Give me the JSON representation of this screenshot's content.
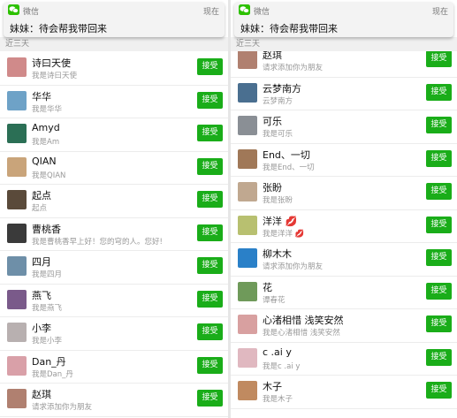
{
  "left": {
    "notification": {
      "app": "微信",
      "time": "现在",
      "message": "妹妹：待会帮我带回来"
    },
    "section_label": "近三天",
    "requests": [
      {
        "name": "诗曰天使",
        "sub": "我是诗曰天使",
        "avatar": "#d08a8a"
      },
      {
        "name": "华华",
        "sub": "我是华华",
        "avatar": "#6ea2c7"
      },
      {
        "name": "Amyd",
        "sub": "我是Am",
        "avatar": "#2b6f55"
      },
      {
        "name": "QIAN",
        "sub": "我是QIAN",
        "avatar": "#c9a47a"
      },
      {
        "name": "起点",
        "sub": "起点",
        "avatar": "#5a4a3a"
      },
      {
        "name": "曹桃香",
        "sub": "我是曹桃香早上好！您的穹的人。您好!",
        "avatar": "#3a3a3a"
      },
      {
        "name": "四月",
        "sub": "我是四月",
        "avatar": "#6e8fa8"
      },
      {
        "name": "燕飞",
        "sub": "我是燕飞",
        "avatar": "#7a5a8a"
      },
      {
        "name": "小李",
        "sub": "我是小李",
        "avatar": "#b8b0b0"
      },
      {
        "name": "Dan_丹",
        "sub": "我是Dan_丹",
        "avatar": "#d9a0a8"
      },
      {
        "name": "赵琪",
        "sub": "请求添加你为朋友",
        "avatar": "#b08070"
      }
    ],
    "accept_label": "接受"
  },
  "right": {
    "notification": {
      "app": "微信",
      "time": "现在",
      "message": "妹妹：待会帮我带回来"
    },
    "section_label": "近三天",
    "requests": [
      {
        "name": "赵琪",
        "sub": "请求添加你为朋友",
        "avatar": "#b08070"
      },
      {
        "name": "云梦南方",
        "sub": "云梦南方",
        "avatar": "#4a6f90"
      },
      {
        "name": "可乐",
        "sub": "我是可乐",
        "avatar": "#8a8f95"
      },
      {
        "name": "End、一切",
        "sub": "我是End、一切",
        "avatar": "#a07858"
      },
      {
        "name": "张盼",
        "sub": "我是张盼",
        "avatar": "#c0a890"
      },
      {
        "name": "洋洋 💋",
        "sub": "我是洋洋 💋",
        "avatar": "#b8c070"
      },
      {
        "name": "柳木木",
        "sub": "请求添加你为朋友",
        "avatar": "#2a80c8"
      },
      {
        "name": "花",
        "sub": "谭春花",
        "avatar": "#6f9a5a"
      },
      {
        "name": "心渚相惜 浅笑安然",
        "sub": "我是心渚相惜 浅笑安然",
        "avatar": "#d8a0a0"
      },
      {
        "name": "c .ai y",
        "sub": "我是c .ai y",
        "avatar": "#e0b8c0"
      },
      {
        "name": "木子",
        "sub": "我是木子",
        "avatar": "#c08a60"
      }
    ],
    "accept_label": "接受"
  }
}
